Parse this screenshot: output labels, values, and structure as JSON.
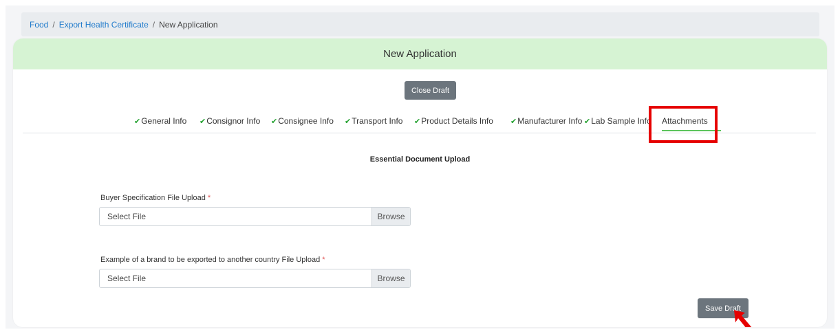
{
  "breadcrumb": {
    "items": [
      "Food",
      "Export Health Certificate"
    ],
    "current": "New Application",
    "separator": "/"
  },
  "card": {
    "title": "New Application",
    "close_draft_label": "Close Draft"
  },
  "tabs": [
    {
      "label": "General Info",
      "completed": true
    },
    {
      "label": "Consignor Info",
      "completed": true
    },
    {
      "label": "Consignee Info",
      "completed": true
    },
    {
      "label": "Transport Info",
      "completed": true
    },
    {
      "label": "Product Details Info",
      "completed": true
    },
    {
      "label": "Manufacturer Info",
      "completed": true
    },
    {
      "label": "Lab Sample Info",
      "completed": true
    },
    {
      "label": "Attachments",
      "completed": false,
      "active": true
    }
  ],
  "check_glyph": "✔",
  "section": {
    "title": "Essential Document Upload"
  },
  "fields": [
    {
      "label": "Buyer Specification File Upload",
      "required_mark": "*",
      "placeholder": "Select File",
      "browse_label": "Browse"
    },
    {
      "label": "Example of a brand to be exported to another country File Upload",
      "required_mark": "*",
      "placeholder": "Select File",
      "browse_label": "Browse"
    }
  ],
  "save_draft_label": "Save Draft",
  "colors": {
    "header_bg": "#d6f3d3",
    "check": "#22a12e",
    "link": "#1f7acb",
    "highlight": "#e60000",
    "button": "#6c757d"
  }
}
